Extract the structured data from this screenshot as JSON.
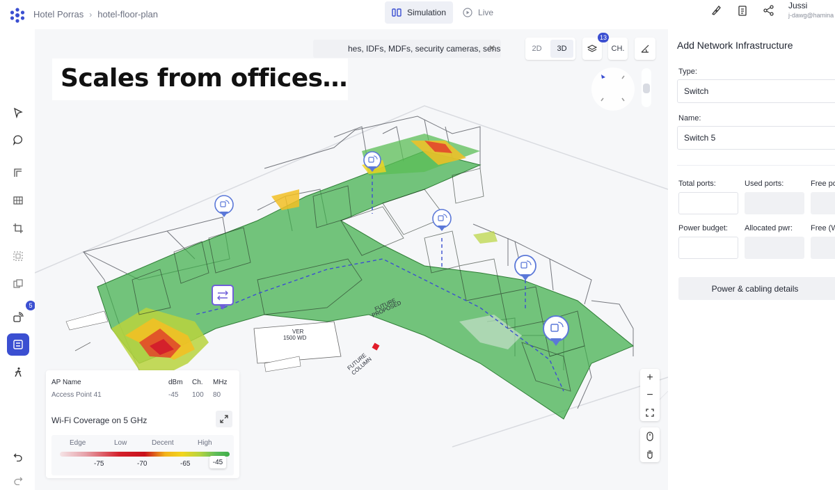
{
  "topbar": {
    "breadcrumb": [
      "Hotel Porras",
      "hotel-floor-plan"
    ],
    "modes": [
      {
        "label": "Simulation",
        "active": true
      },
      {
        "label": "Live",
        "active": false
      }
    ],
    "user": {
      "name": "Jussi",
      "handle": "j-dawg@hamina"
    }
  },
  "left_toolbar": {
    "badge_count": "5"
  },
  "canvas": {
    "caption": "Scales from offices…",
    "filter_text": "hes, IDFs, MDFs, security cameras, sensors, etc.",
    "view_2d": "2D",
    "view_3d": "3D",
    "layers_badge": "13",
    "channel_label": "CH.",
    "plan_labels": {
      "ver": "VER",
      "ver_sub": "1500 WD",
      "future_proposed_1": "FUTURE",
      "future_proposed_2": "PROPOSED",
      "future_column_1": "FUTURE",
      "future_column_2": "COLUMN"
    }
  },
  "ap_info": {
    "headers": [
      "AP Name",
      "dBm",
      "Ch.",
      "MHz"
    ],
    "row": [
      "Access Point 41",
      "-45",
      "100",
      "80"
    ],
    "coverage_title": "Wi-Fi Coverage on 5 GHz",
    "legend_labels": [
      "Edge",
      "Low",
      "Decent",
      "High"
    ],
    "legend_ticks": [
      "-75",
      "-70",
      "-65"
    ],
    "legend_selected": "-45"
  },
  "right_panel": {
    "title": "Add Network Infrastructure",
    "type_label": "Type:",
    "type_value": "Switch",
    "name_label": "Name:",
    "name_value": "Switch 5",
    "total_ports_label": "Total ports:",
    "used_ports_label": "Used ports:",
    "free_ports_label": "Free po",
    "power_budget_label": "Power budget:",
    "allocated_pwr_label": "Allocated pwr:",
    "free_w_label": "Free (W",
    "details_button": "Power & cabling details"
  },
  "colors": {
    "accent": "#3b4fd1",
    "coverage_high": "#3fae4a",
    "coverage_low": "#d4202b",
    "coverage_decent": "#f2d51e"
  }
}
